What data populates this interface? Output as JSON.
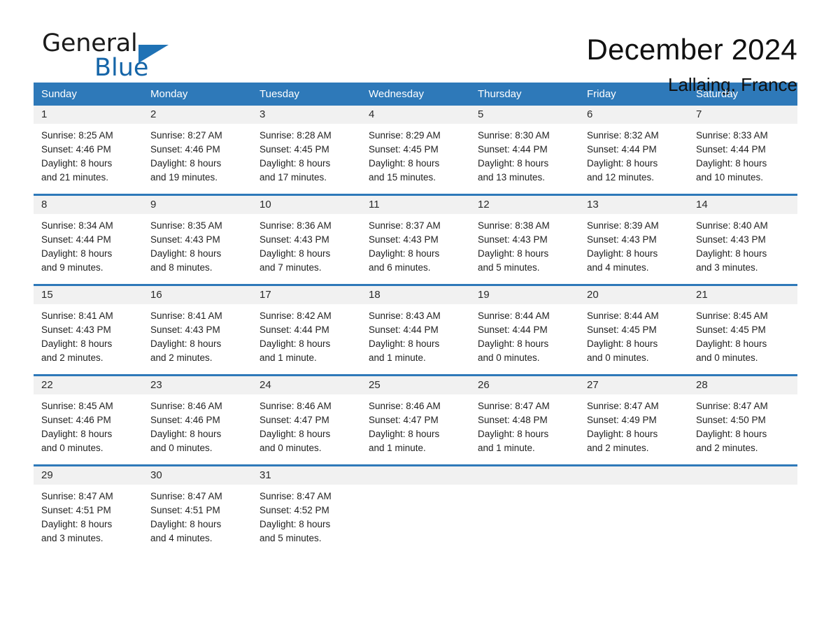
{
  "brand": {
    "line1": "General",
    "line2": "Blue",
    "triangle_color": "#1f72b5",
    "text_color": "#1565a8"
  },
  "header": {
    "month_title": "December 2024",
    "location": "Lallaing, France"
  },
  "colors": {
    "header_blue": "#2e79b9",
    "daynum_band": "#f1f1f1",
    "page_background": "#ffffff",
    "text": "#1f1f1f"
  },
  "weekdays": [
    "Sunday",
    "Monday",
    "Tuesday",
    "Wednesday",
    "Thursday",
    "Friday",
    "Saturday"
  ],
  "weeks": [
    {
      "days": [
        {
          "num": "1",
          "sunrise": "Sunrise: 8:25 AM",
          "sunset": "Sunset: 4:46 PM",
          "daylight1": "Daylight: 8 hours",
          "daylight2": "and 21 minutes."
        },
        {
          "num": "2",
          "sunrise": "Sunrise: 8:27 AM",
          "sunset": "Sunset: 4:46 PM",
          "daylight1": "Daylight: 8 hours",
          "daylight2": "and 19 minutes."
        },
        {
          "num": "3",
          "sunrise": "Sunrise: 8:28 AM",
          "sunset": "Sunset: 4:45 PM",
          "daylight1": "Daylight: 8 hours",
          "daylight2": "and 17 minutes."
        },
        {
          "num": "4",
          "sunrise": "Sunrise: 8:29 AM",
          "sunset": "Sunset: 4:45 PM",
          "daylight1": "Daylight: 8 hours",
          "daylight2": "and 15 minutes."
        },
        {
          "num": "5",
          "sunrise": "Sunrise: 8:30 AM",
          "sunset": "Sunset: 4:44 PM",
          "daylight1": "Daylight: 8 hours",
          "daylight2": "and 13 minutes."
        },
        {
          "num": "6",
          "sunrise": "Sunrise: 8:32 AM",
          "sunset": "Sunset: 4:44 PM",
          "daylight1": "Daylight: 8 hours",
          "daylight2": "and 12 minutes."
        },
        {
          "num": "7",
          "sunrise": "Sunrise: 8:33 AM",
          "sunset": "Sunset: 4:44 PM",
          "daylight1": "Daylight: 8 hours",
          "daylight2": "and 10 minutes."
        }
      ]
    },
    {
      "days": [
        {
          "num": "8",
          "sunrise": "Sunrise: 8:34 AM",
          "sunset": "Sunset: 4:44 PM",
          "daylight1": "Daylight: 8 hours",
          "daylight2": "and 9 minutes."
        },
        {
          "num": "9",
          "sunrise": "Sunrise: 8:35 AM",
          "sunset": "Sunset: 4:43 PM",
          "daylight1": "Daylight: 8 hours",
          "daylight2": "and 8 minutes."
        },
        {
          "num": "10",
          "sunrise": "Sunrise: 8:36 AM",
          "sunset": "Sunset: 4:43 PM",
          "daylight1": "Daylight: 8 hours",
          "daylight2": "and 7 minutes."
        },
        {
          "num": "11",
          "sunrise": "Sunrise: 8:37 AM",
          "sunset": "Sunset: 4:43 PM",
          "daylight1": "Daylight: 8 hours",
          "daylight2": "and 6 minutes."
        },
        {
          "num": "12",
          "sunrise": "Sunrise: 8:38 AM",
          "sunset": "Sunset: 4:43 PM",
          "daylight1": "Daylight: 8 hours",
          "daylight2": "and 5 minutes."
        },
        {
          "num": "13",
          "sunrise": "Sunrise: 8:39 AM",
          "sunset": "Sunset: 4:43 PM",
          "daylight1": "Daylight: 8 hours",
          "daylight2": "and 4 minutes."
        },
        {
          "num": "14",
          "sunrise": "Sunrise: 8:40 AM",
          "sunset": "Sunset: 4:43 PM",
          "daylight1": "Daylight: 8 hours",
          "daylight2": "and 3 minutes."
        }
      ]
    },
    {
      "days": [
        {
          "num": "15",
          "sunrise": "Sunrise: 8:41 AM",
          "sunset": "Sunset: 4:43 PM",
          "daylight1": "Daylight: 8 hours",
          "daylight2": "and 2 minutes."
        },
        {
          "num": "16",
          "sunrise": "Sunrise: 8:41 AM",
          "sunset": "Sunset: 4:43 PM",
          "daylight1": "Daylight: 8 hours",
          "daylight2": "and 2 minutes."
        },
        {
          "num": "17",
          "sunrise": "Sunrise: 8:42 AM",
          "sunset": "Sunset: 4:44 PM",
          "daylight1": "Daylight: 8 hours",
          "daylight2": "and 1 minute."
        },
        {
          "num": "18",
          "sunrise": "Sunrise: 8:43 AM",
          "sunset": "Sunset: 4:44 PM",
          "daylight1": "Daylight: 8 hours",
          "daylight2": "and 1 minute."
        },
        {
          "num": "19",
          "sunrise": "Sunrise: 8:44 AM",
          "sunset": "Sunset: 4:44 PM",
          "daylight1": "Daylight: 8 hours",
          "daylight2": "and 0 minutes."
        },
        {
          "num": "20",
          "sunrise": "Sunrise: 8:44 AM",
          "sunset": "Sunset: 4:45 PM",
          "daylight1": "Daylight: 8 hours",
          "daylight2": "and 0 minutes."
        },
        {
          "num": "21",
          "sunrise": "Sunrise: 8:45 AM",
          "sunset": "Sunset: 4:45 PM",
          "daylight1": "Daylight: 8 hours",
          "daylight2": "and 0 minutes."
        }
      ]
    },
    {
      "days": [
        {
          "num": "22",
          "sunrise": "Sunrise: 8:45 AM",
          "sunset": "Sunset: 4:46 PM",
          "daylight1": "Daylight: 8 hours",
          "daylight2": "and 0 minutes."
        },
        {
          "num": "23",
          "sunrise": "Sunrise: 8:46 AM",
          "sunset": "Sunset: 4:46 PM",
          "daylight1": "Daylight: 8 hours",
          "daylight2": "and 0 minutes."
        },
        {
          "num": "24",
          "sunrise": "Sunrise: 8:46 AM",
          "sunset": "Sunset: 4:47 PM",
          "daylight1": "Daylight: 8 hours",
          "daylight2": "and 0 minutes."
        },
        {
          "num": "25",
          "sunrise": "Sunrise: 8:46 AM",
          "sunset": "Sunset: 4:47 PM",
          "daylight1": "Daylight: 8 hours",
          "daylight2": "and 1 minute."
        },
        {
          "num": "26",
          "sunrise": "Sunrise: 8:47 AM",
          "sunset": "Sunset: 4:48 PM",
          "daylight1": "Daylight: 8 hours",
          "daylight2": "and 1 minute."
        },
        {
          "num": "27",
          "sunrise": "Sunrise: 8:47 AM",
          "sunset": "Sunset: 4:49 PM",
          "daylight1": "Daylight: 8 hours",
          "daylight2": "and 2 minutes."
        },
        {
          "num": "28",
          "sunrise": "Sunrise: 8:47 AM",
          "sunset": "Sunset: 4:50 PM",
          "daylight1": "Daylight: 8 hours",
          "daylight2": "and 2 minutes."
        }
      ]
    },
    {
      "days": [
        {
          "num": "29",
          "sunrise": "Sunrise: 8:47 AM",
          "sunset": "Sunset: 4:51 PM",
          "daylight1": "Daylight: 8 hours",
          "daylight2": "and 3 minutes."
        },
        {
          "num": "30",
          "sunrise": "Sunrise: 8:47 AM",
          "sunset": "Sunset: 4:51 PM",
          "daylight1": "Daylight: 8 hours",
          "daylight2": "and 4 minutes."
        },
        {
          "num": "31",
          "sunrise": "Sunrise: 8:47 AM",
          "sunset": "Sunset: 4:52 PM",
          "daylight1": "Daylight: 8 hours",
          "daylight2": "and 5 minutes."
        },
        {
          "num": "",
          "sunrise": "",
          "sunset": "",
          "daylight1": "",
          "daylight2": ""
        },
        {
          "num": "",
          "sunrise": "",
          "sunset": "",
          "daylight1": "",
          "daylight2": ""
        },
        {
          "num": "",
          "sunrise": "",
          "sunset": "",
          "daylight1": "",
          "daylight2": ""
        },
        {
          "num": "",
          "sunrise": "",
          "sunset": "",
          "daylight1": "",
          "daylight2": ""
        }
      ]
    }
  ]
}
